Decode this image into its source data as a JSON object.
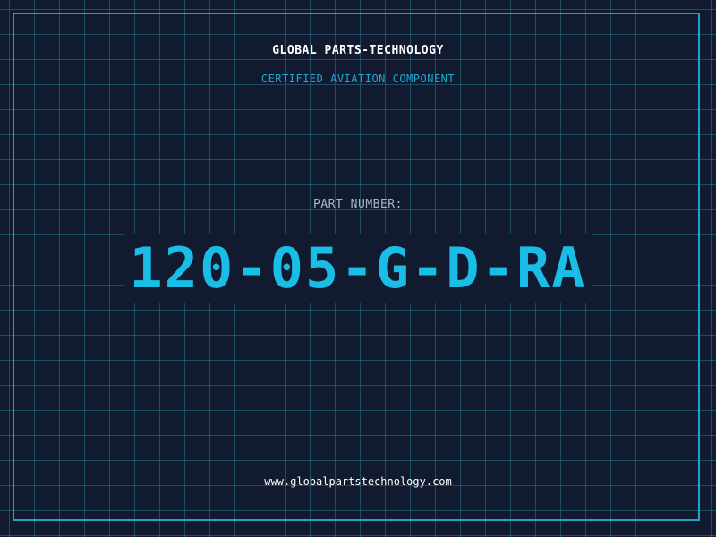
{
  "header": {
    "company": "GLOBAL PARTS-TECHNOLOGY",
    "tagline": "CERTIFIED AVIATION COMPONENT"
  },
  "part": {
    "label": "PART NUMBER:",
    "number": "120-05-G-D-RA"
  },
  "footer": {
    "url": "www.globalpartstechnology.com"
  },
  "colors": {
    "background": "#121a2f",
    "grid": "#1f6f80",
    "accent": "#19bde6",
    "frame": "#1aa6c9",
    "text": "#ffffff",
    "muted": "#aab6c8"
  }
}
